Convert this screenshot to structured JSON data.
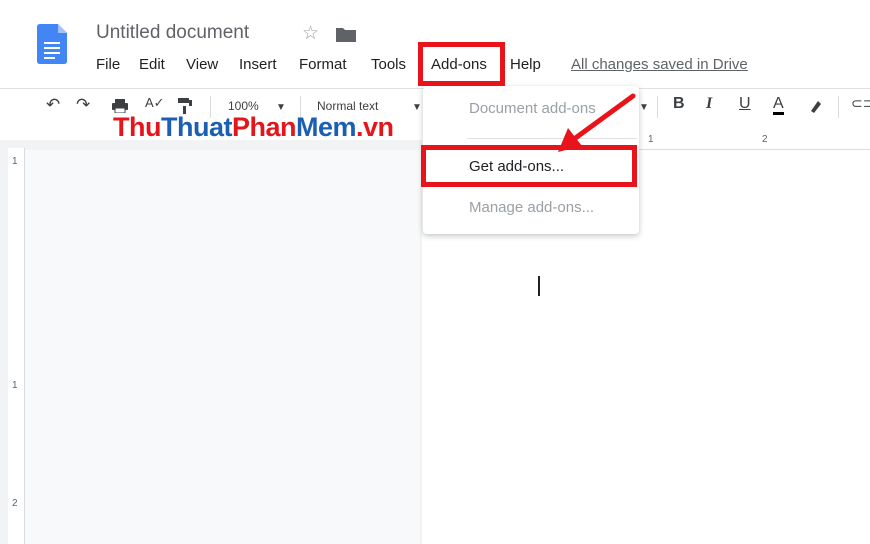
{
  "header": {
    "title": "Untitled document",
    "saved_status": "All changes saved in Drive",
    "star_icon": "star-icon",
    "folder_icon": "folder-icon"
  },
  "menubar": {
    "items": [
      {
        "label": "File"
      },
      {
        "label": "Edit"
      },
      {
        "label": "View"
      },
      {
        "label": "Insert"
      },
      {
        "label": "Format"
      },
      {
        "label": "Tools"
      },
      {
        "label": "Add-ons"
      },
      {
        "label": "Help"
      }
    ]
  },
  "toolbar": {
    "zoom": "100%",
    "style": "Normal text",
    "bold": "B",
    "italic": "I",
    "underline": "U",
    "text_color": "A"
  },
  "ruler": {
    "top_marks": [
      "1",
      "2"
    ],
    "left_marks": [
      "1",
      "1",
      "2"
    ]
  },
  "dropdown": {
    "items": [
      {
        "label": "Document add-ons",
        "enabled": false
      },
      {
        "label": "Get add-ons...",
        "enabled": true
      },
      {
        "label": "Manage add-ons...",
        "enabled": false
      }
    ]
  },
  "watermark": {
    "part1": "Thu",
    "part2": "Thuat",
    "part3": "Phan",
    "part4": "Mem",
    "part5": ".vn"
  },
  "colors": {
    "highlight": "#e8131b",
    "brand_blue": "#4285f4"
  }
}
